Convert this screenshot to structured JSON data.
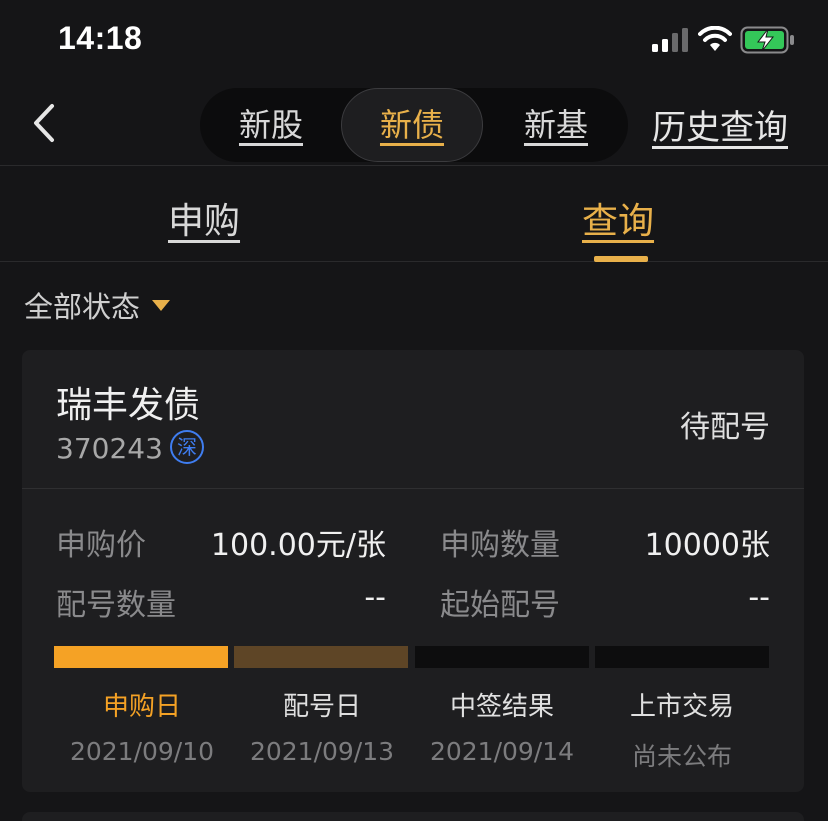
{
  "status_bar": {
    "time": "14:18"
  },
  "nav": {
    "segments": [
      {
        "label": "新股",
        "active": false
      },
      {
        "label": "新债",
        "active": true
      },
      {
        "label": "新基",
        "active": false
      }
    ],
    "history_label": "历史查询"
  },
  "tabs": [
    {
      "label": "申购",
      "active": false
    },
    {
      "label": "查询",
      "active": true
    }
  ],
  "filter": {
    "label": "全部状态"
  },
  "card": {
    "name": "瑞丰发债",
    "code": "370243",
    "exchange": "深",
    "status": "待配号",
    "fields": {
      "price_label": "申购价",
      "price_value": "100.00元/张",
      "quantity_label": "申购数量",
      "quantity_value": "10000张",
      "alloc_count_label": "配号数量",
      "alloc_count_value": "--",
      "start_no_label": "起始配号",
      "start_no_value": "--"
    },
    "steps": [
      {
        "label": "申购日",
        "date": "2021/09/10",
        "state": "done"
      },
      {
        "label": "配号日",
        "date": "2021/09/13",
        "state": "next"
      },
      {
        "label": "中签结果",
        "date": "2021/09/14",
        "state": "pending"
      },
      {
        "label": "上市交易",
        "date": "尚未公布",
        "state": "pending"
      }
    ]
  },
  "colors": {
    "accent": "#e8b04a",
    "progress_active": "#f5a225",
    "progress_next": "#5e4526",
    "badge_blue": "#3f7df0"
  }
}
